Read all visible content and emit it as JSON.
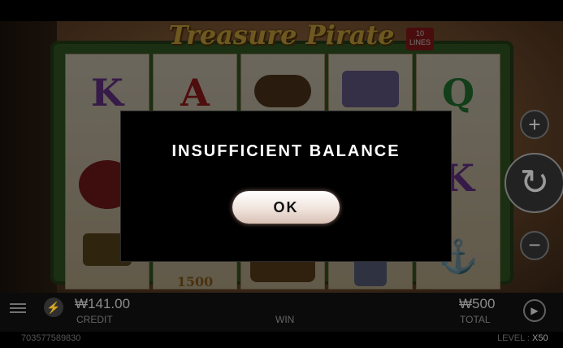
{
  "game": {
    "logo_text": "Treasure Pirate",
    "lines_badge": "10 LINES",
    "reel_symbols": [
      "K",
      "A",
      "spyglass",
      "scroll",
      "Q",
      "treasure-chest",
      "K",
      "anchor",
      "tiles-1500"
    ],
    "tile_value": "1500"
  },
  "controls": {
    "plus_symbol": "+",
    "spin_symbol": "↻",
    "minus_symbol": "−"
  },
  "dialog": {
    "message": "INSUFFICIENT BALANCE",
    "ok_label": "OK"
  },
  "status": {
    "credit_value": "₩141.00",
    "credit_label": "CREDIT",
    "win_label": "WIN",
    "total_value": "₩500",
    "total_label": "TOTAL",
    "session_id": "703577589830",
    "level_label": "LEVEL :",
    "level_value": "X50"
  },
  "icons": {
    "menu": "menu-icon",
    "quick_spin": "lightning-bolt-icon",
    "autoplay": "autoplay-icon",
    "spin": "refresh-spin-icon"
  }
}
